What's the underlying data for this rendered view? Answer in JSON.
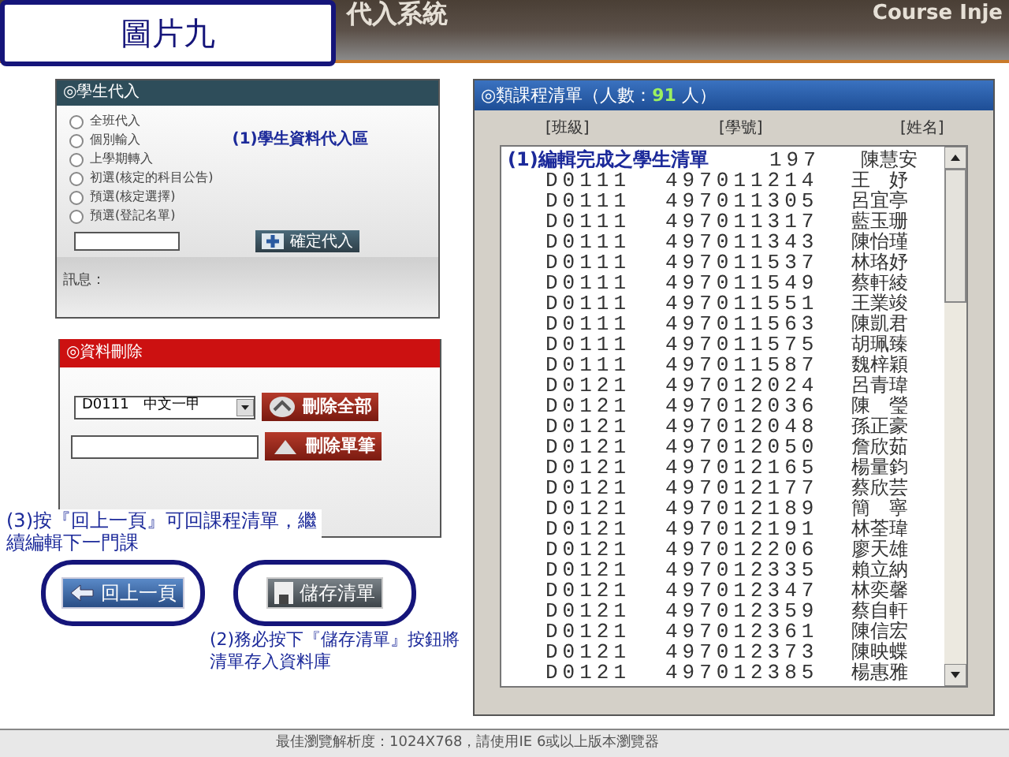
{
  "caption": "圖片九",
  "header": {
    "title": "代入系統",
    "subtitle": "Course Inje"
  },
  "import_panel": {
    "title": "◎學生代入",
    "options": [
      {
        "label": "全班代入",
        "selected": false
      },
      {
        "label": "個別輸入",
        "selected": false
      },
      {
        "label": "上學期轉入",
        "selected": false
      },
      {
        "label": "初選(核定的科目公告)",
        "selected": false
      },
      {
        "label": "預選(核定選擇)",
        "selected": false
      },
      {
        "label": "預選(登記名單)",
        "selected": false
      }
    ],
    "annotation": "(1)學生資料代入區",
    "button": "確定代入",
    "message_label": "訊息："
  },
  "delete_panel": {
    "title": "◎資料刪除",
    "select_value": "D0111　中文一甲",
    "delete_all_button": "刪除全部",
    "delete_one_button": "刪除單筆"
  },
  "back_annotation": "(3)按『回上一頁』可回課程清單，繼續編輯下一門課",
  "back_button": "回上一頁",
  "save_button": "儲存清單",
  "save_annotation": "(2)務必按下『儲存清單』按鈕將清單存入資料庫",
  "course_list": {
    "title": "◎類課程清單（人數：",
    "count": "91",
    "count_unit": "人）",
    "columns": [
      "[班級]",
      "[學號]",
      "[姓名]"
    ],
    "rows": [
      {
        "kind": "annotated",
        "note": "(1)編輯完成之學生清單",
        "id": "197",
        "name": "陳慧安"
      },
      {
        "kind": "row",
        "class": "D0111",
        "id": "497011214",
        "name": "王　妤"
      },
      {
        "kind": "row",
        "class": "D0111",
        "id": "497011305",
        "name": "呂宜亭"
      },
      {
        "kind": "row",
        "class": "D0111",
        "id": "497011317",
        "name": "藍玉珊"
      },
      {
        "kind": "row",
        "class": "D0111",
        "id": "497011343",
        "name": "陳怡瑾"
      },
      {
        "kind": "row",
        "class": "D0111",
        "id": "497011537",
        "name": "林珞妤"
      },
      {
        "kind": "row",
        "class": "D0111",
        "id": "497011549",
        "name": "蔡軒綾"
      },
      {
        "kind": "row",
        "class": "D0111",
        "id": "497011551",
        "name": "王業竣"
      },
      {
        "kind": "row",
        "class": "D0111",
        "id": "497011563",
        "name": "陳凱君"
      },
      {
        "kind": "row",
        "class": "D0111",
        "id": "497011575",
        "name": "胡珮臻"
      },
      {
        "kind": "row",
        "class": "D0111",
        "id": "497011587",
        "name": "魏梓穎"
      },
      {
        "kind": "row",
        "class": "D0121",
        "id": "497012024",
        "name": "呂青瑋"
      },
      {
        "kind": "row",
        "class": "D0121",
        "id": "497012036",
        "name": "陳　瑩"
      },
      {
        "kind": "row",
        "class": "D0121",
        "id": "497012048",
        "name": "孫正豪"
      },
      {
        "kind": "row",
        "class": "D0121",
        "id": "497012050",
        "name": "詹欣茹"
      },
      {
        "kind": "row",
        "class": "D0121",
        "id": "497012165",
        "name": "楊量鈞"
      },
      {
        "kind": "row",
        "class": "D0121",
        "id": "497012177",
        "name": "蔡欣芸"
      },
      {
        "kind": "row",
        "class": "D0121",
        "id": "497012189",
        "name": "簡　寧"
      },
      {
        "kind": "row",
        "class": "D0121",
        "id": "497012191",
        "name": "林荃瑋"
      },
      {
        "kind": "row",
        "class": "D0121",
        "id": "497012206",
        "name": "廖天雄"
      },
      {
        "kind": "row",
        "class": "D0121",
        "id": "497012335",
        "name": "賴立納"
      },
      {
        "kind": "row",
        "class": "D0121",
        "id": "497012347",
        "name": "林奕馨"
      },
      {
        "kind": "row",
        "class": "D0121",
        "id": "497012359",
        "name": "蔡自軒"
      },
      {
        "kind": "row",
        "class": "D0121",
        "id": "497012361",
        "name": "陳信宏"
      },
      {
        "kind": "row",
        "class": "D0121",
        "id": "497012373",
        "name": "陳映蝶"
      },
      {
        "kind": "row",
        "class": "D0121",
        "id": "497012385",
        "name": "楊惠雅"
      }
    ]
  },
  "footer": "最佳瀏覽解析度：1024X768，請使用IE 6或以上版本瀏覽器"
}
